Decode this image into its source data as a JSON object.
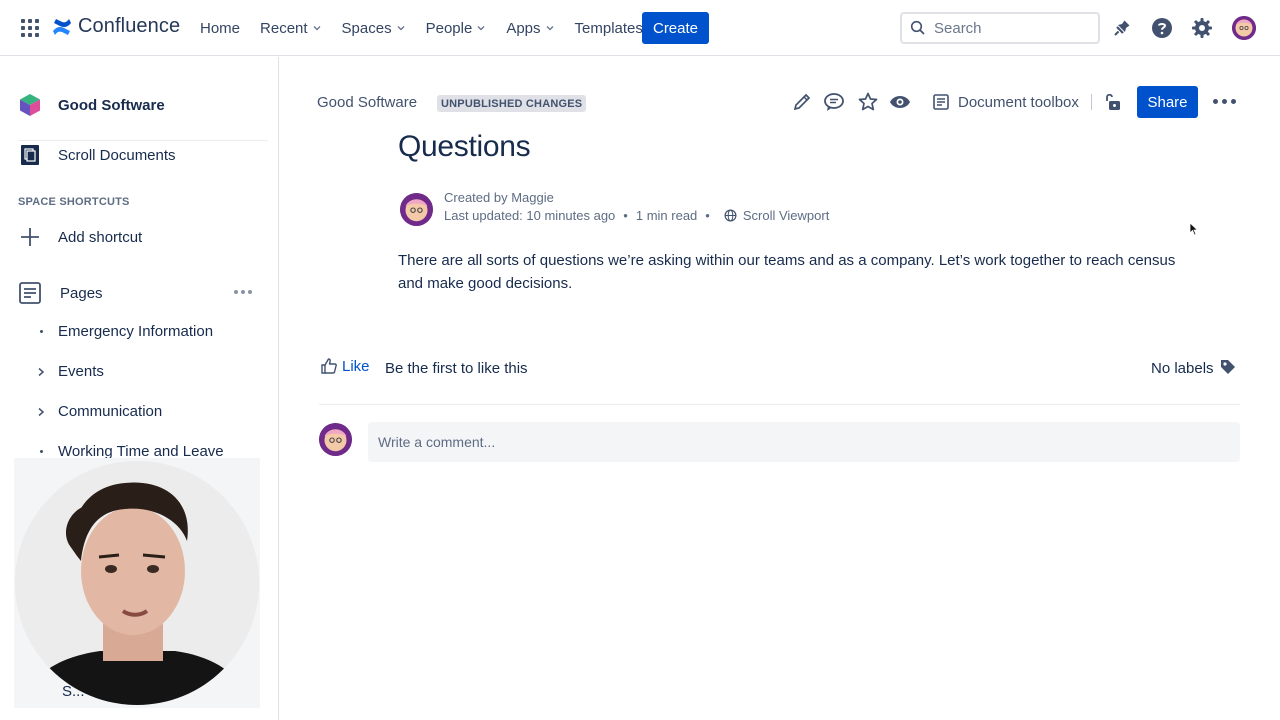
{
  "nav": {
    "logo_text": "Confluence",
    "items": [
      {
        "label": "Home",
        "dropdown": false
      },
      {
        "label": "Recent",
        "dropdown": true
      },
      {
        "label": "Spaces",
        "dropdown": true
      },
      {
        "label": "People",
        "dropdown": true
      },
      {
        "label": "Apps",
        "dropdown": true
      },
      {
        "label": "Templates",
        "dropdown": false
      }
    ],
    "create_label": "Create",
    "search_placeholder": "Search"
  },
  "sidebar": {
    "space_name": "Good Software",
    "scroll_documents": "Scroll Documents",
    "shortcuts_heading": "SPACE SHORTCUTS",
    "add_shortcut": "Add shortcut",
    "pages_label": "Pages",
    "tree": [
      {
        "label": "Emergency Information",
        "type": "bullet"
      },
      {
        "label": "Events",
        "type": "expand"
      },
      {
        "label": "Communication",
        "type": "expand"
      },
      {
        "label": "Working Time and Leave",
        "type": "bullet"
      }
    ],
    "partial_item": "S... ...n-App H..."
  },
  "page": {
    "breadcrumb": "Good Software",
    "status_badge": "UNPUBLISHED CHANGES",
    "document_toolbox": "Document toolbox",
    "share_label": "Share",
    "title": "Questions",
    "created_by": "Created by Maggie",
    "last_updated": "Last updated: 10 minutes ago",
    "read_time": "1 min read",
    "viewport_link": "Scroll Viewport",
    "body": "There are all sorts of questions we’re asking within our teams and as a company. Let’s work together to reach census and make good decisions.",
    "like_label": "Like",
    "like_hint": "Be the first to like this",
    "labels_text": "No labels",
    "comment_placeholder": "Write a comment..."
  },
  "colors": {
    "primary": "#0052cc",
    "text": "#172b4d",
    "subtle": "#5e6c84",
    "badge_bg": "#dfe1e6"
  }
}
